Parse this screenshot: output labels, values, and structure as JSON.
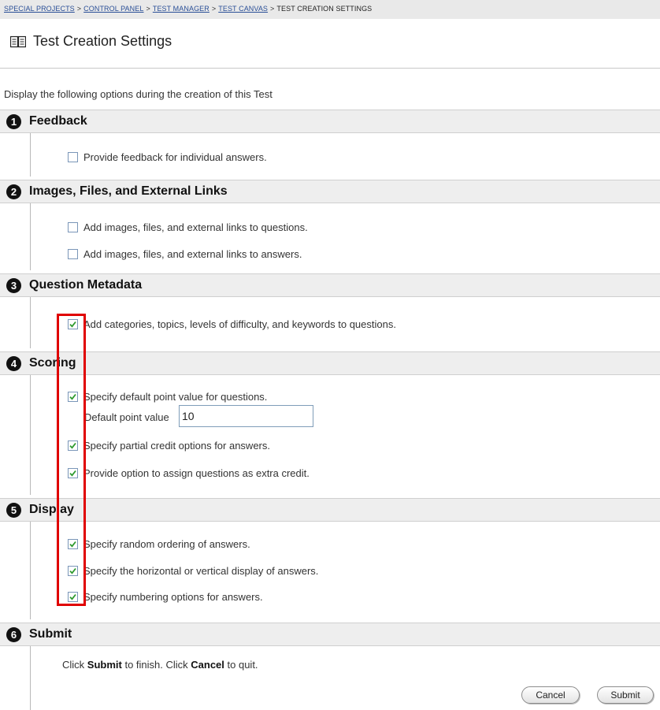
{
  "breadcrumb": [
    {
      "label": "SPECIAL PROJECTS",
      "link": true
    },
    {
      "label": "CONTROL PANEL",
      "link": true
    },
    {
      "label": "TEST MANAGER",
      "link": true
    },
    {
      "label": "TEST CANVAS",
      "link": true
    },
    {
      "label": "TEST CREATION SETTINGS",
      "link": false
    }
  ],
  "breadcrumb_separator": ">",
  "page": {
    "title": "Test Creation Settings",
    "icon": "open-book-icon",
    "intro": "Display the following options during the creation of this Test"
  },
  "steps": [
    {
      "number": "1",
      "title": "Feedback"
    },
    {
      "number": "2",
      "title": "Images, Files, and External Links"
    },
    {
      "number": "3",
      "title": "Question Metadata"
    },
    {
      "number": "4",
      "title": "Scoring"
    },
    {
      "number": "5",
      "title": "Display"
    },
    {
      "number": "6",
      "title": "Submit"
    }
  ],
  "options": {
    "feedback": {
      "label": "Provide feedback for individual answers.",
      "checked": false
    },
    "images_questions": {
      "label": "Add images, files, and external links to questions.",
      "checked": false
    },
    "images_answers": {
      "label": "Add images, files, and external links to answers.",
      "checked": false
    },
    "metadata": {
      "label": "Add categories, topics, levels of difficulty, and keywords to questions.",
      "checked": true
    },
    "default_points": {
      "label": "Specify default point value for questions.",
      "checked": true
    },
    "partial_credit": {
      "label": "Specify partial credit options for answers.",
      "checked": true
    },
    "extra_credit": {
      "label": "Provide option to assign questions as extra credit.",
      "checked": true
    },
    "random_order": {
      "label": "Specify random ordering of answers.",
      "checked": true
    },
    "horiz_vert": {
      "label": "Specify the horizontal or vertical display of answers.",
      "checked": true
    },
    "numbering": {
      "label": "Specify numbering options for answers.",
      "checked": true
    }
  },
  "default_point": {
    "label": "Default point value",
    "value": "10"
  },
  "submit_section": {
    "text_1": "Click ",
    "submit_word": "Submit",
    "text_2": " to finish. Click ",
    "cancel_word": "Cancel",
    "text_3": " to quit."
  },
  "buttons": {
    "cancel": "Cancel",
    "submit": "Submit"
  },
  "colors": {
    "highlight": "#e00000",
    "link": "#2a4f97",
    "check": "#2e9a2e",
    "header_bg": "#eeeeee"
  }
}
